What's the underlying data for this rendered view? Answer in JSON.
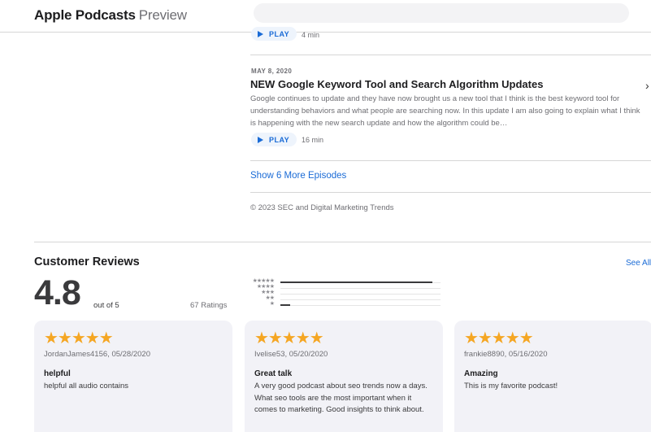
{
  "header": {
    "brand": "Apple Podcasts",
    "brand_suffix": "Preview"
  },
  "episodes": {
    "top": {
      "play_label": "PLAY",
      "duration": "4 min"
    },
    "item": {
      "date": "MAY 8, 2020",
      "title": "NEW Google Keyword Tool and Search Algorithm Updates",
      "description": "Google continues to update and they have now brought us a new tool that I think is the best keyword tool for understanding behaviors and what people are searching now. In this update I am also going to explain what I think is happening with the new search update and how the algorithm could be…",
      "play_label": "PLAY",
      "duration": "16 min"
    },
    "show_more": "Show 6 More Episodes",
    "copyright": "© 2023 SEC and Digital Marketing Trends"
  },
  "reviews": {
    "section_title": "Customer Reviews",
    "see_all": "See All",
    "rating": "4.8",
    "out_of": "out of 5",
    "ratings_count": "67 Ratings",
    "histogram": [
      {
        "stars": "★★★★★",
        "fraction": 0.95
      },
      {
        "stars": "★★★★",
        "fraction": 0.0
      },
      {
        "stars": "★★★",
        "fraction": 0.0
      },
      {
        "stars": "★★",
        "fraction": 0.0
      },
      {
        "stars": "★",
        "fraction": 0.06
      }
    ],
    "cards": [
      {
        "stars": "★★★★★",
        "author_date": "JordanJames4156, 05/28/2020",
        "title": "helpful",
        "body": "helpful all audio contains"
      },
      {
        "stars": "★★★★★",
        "author_date": "Ivelise53, 05/20/2020",
        "title": "Great talk",
        "body": "A very good podcast about seo trends now a days. What seo tools are the most important when it comes to marketing. Good insights to think about."
      },
      {
        "stars": "★★★★★",
        "author_date": "frankie8890, 05/16/2020",
        "title": "Amazing",
        "body": "This is my favorite podcast!"
      }
    ]
  },
  "colors": {
    "accent": "#1a6bd6",
    "star": "#f5a623",
    "card_bg": "#f2f2f7"
  }
}
